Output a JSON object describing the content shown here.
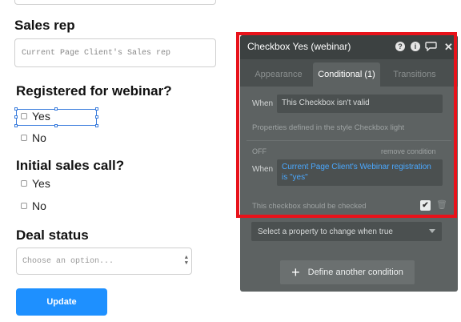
{
  "form": {
    "sales_rep": {
      "title": "Sales rep",
      "placeholder": "Current Page Client's Sales rep"
    },
    "webinar": {
      "title": "Registered for webinar?",
      "options": [
        "Yes",
        "No"
      ]
    },
    "initial_call": {
      "title": "Initial sales call?",
      "options": [
        "Yes",
        "No"
      ]
    },
    "deal_status": {
      "title": "Deal status",
      "placeholder": "Choose an option..."
    },
    "update_label": "Update"
  },
  "panel": {
    "title": "Checkbox Yes (webinar)",
    "header_icons": [
      "help-icon",
      "info-icon",
      "comment-icon",
      "close-icon"
    ],
    "tabs": [
      {
        "label": "Appearance",
        "active": false
      },
      {
        "label": "Conditional (1)",
        "active": true
      },
      {
        "label": "Transitions",
        "active": false
      }
    ],
    "condition1": {
      "when_label": "When",
      "when_value": "This Checkbox isn't valid",
      "style_note": "Properties defined in the style Checkbox light"
    },
    "condition2": {
      "off_label": "OFF",
      "remove_label": "remove condition",
      "when_label": "When",
      "when_value": "Current Page Client's Webinar registration is \"yes\"",
      "property_label": "This checkbox should be checked",
      "checked": true
    },
    "select_property_placeholder": "Select a property to change when true",
    "define_label": "Define another condition",
    "colors": {
      "panel_bg": "#5d6262",
      "header_bg": "#3c4141",
      "highlight": "#e8121a",
      "link": "#4aa8ff",
      "button": "#1e90ff"
    }
  }
}
